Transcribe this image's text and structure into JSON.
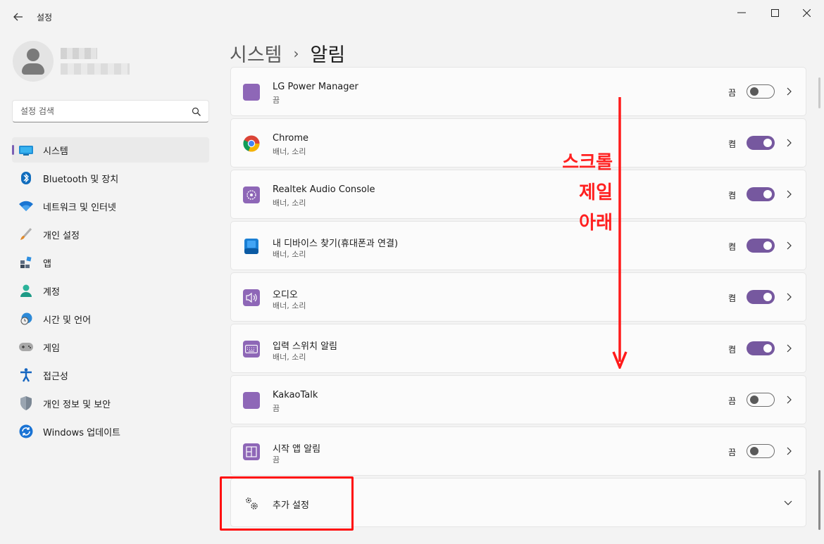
{
  "window": {
    "app_title": "설정",
    "back_icon": "arrow-left-icon"
  },
  "sidebar": {
    "search_placeholder": "설정 검색",
    "items": [
      {
        "label": "시스템",
        "icon": "system-display-icon",
        "active": true
      },
      {
        "label": "Bluetooth 및 장치",
        "icon": "bluetooth-icon"
      },
      {
        "label": "네트워크 및 인터넷",
        "icon": "wifi-icon"
      },
      {
        "label": "개인 설정",
        "icon": "paintbrush-icon"
      },
      {
        "label": "앱",
        "icon": "apps-icon"
      },
      {
        "label": "계정",
        "icon": "account-icon"
      },
      {
        "label": "시간 및 언어",
        "icon": "globe-clock-icon"
      },
      {
        "label": "게임",
        "icon": "gamepad-icon"
      },
      {
        "label": "접근성",
        "icon": "accessibility-icon"
      },
      {
        "label": "개인 정보 및 보안",
        "icon": "shield-icon"
      },
      {
        "label": "Windows 업데이트",
        "icon": "windows-update-icon"
      }
    ]
  },
  "header": {
    "parent": "시스템",
    "separator": "›",
    "current": "알림"
  },
  "apps": [
    {
      "title": "LG Power Manager",
      "subtitle": "끔",
      "state": "끔",
      "on": false,
      "icon": "lg-power-manager-icon"
    },
    {
      "title": "Chrome",
      "subtitle": "배너, 소리",
      "state": "켬",
      "on": true,
      "icon": "chrome-icon"
    },
    {
      "title": "Realtek Audio Console",
      "subtitle": "배너, 소리",
      "state": "켬",
      "on": true,
      "icon": "realtek-audio-icon"
    },
    {
      "title": "내 디바이스 찾기(휴대폰과 연결)",
      "subtitle": "배너, 소리",
      "state": "켬",
      "on": true,
      "icon": "phone-link-icon"
    },
    {
      "title": "오디오",
      "subtitle": "배너, 소리",
      "state": "켬",
      "on": true,
      "icon": "speaker-icon"
    },
    {
      "title": "입력 스위치 알림",
      "subtitle": "배너, 소리",
      "state": "켬",
      "on": true,
      "icon": "keyboard-icon"
    },
    {
      "title": "KakaoTalk",
      "subtitle": "끔",
      "state": "끔",
      "on": false,
      "icon": "kakaotalk-icon"
    },
    {
      "title": "시작 앱 알림",
      "subtitle": "끔",
      "state": "끔",
      "on": false,
      "icon": "startup-apps-icon"
    }
  ],
  "additional_settings": {
    "label": "추가 설정",
    "icon": "gears-icon"
  },
  "annotation": {
    "lines": [
      "스크롤",
      "제일",
      "아래"
    ],
    "color": "#ff2020"
  },
  "colors": {
    "accent": "#76589f",
    "annotation": "#ff0c0c"
  }
}
